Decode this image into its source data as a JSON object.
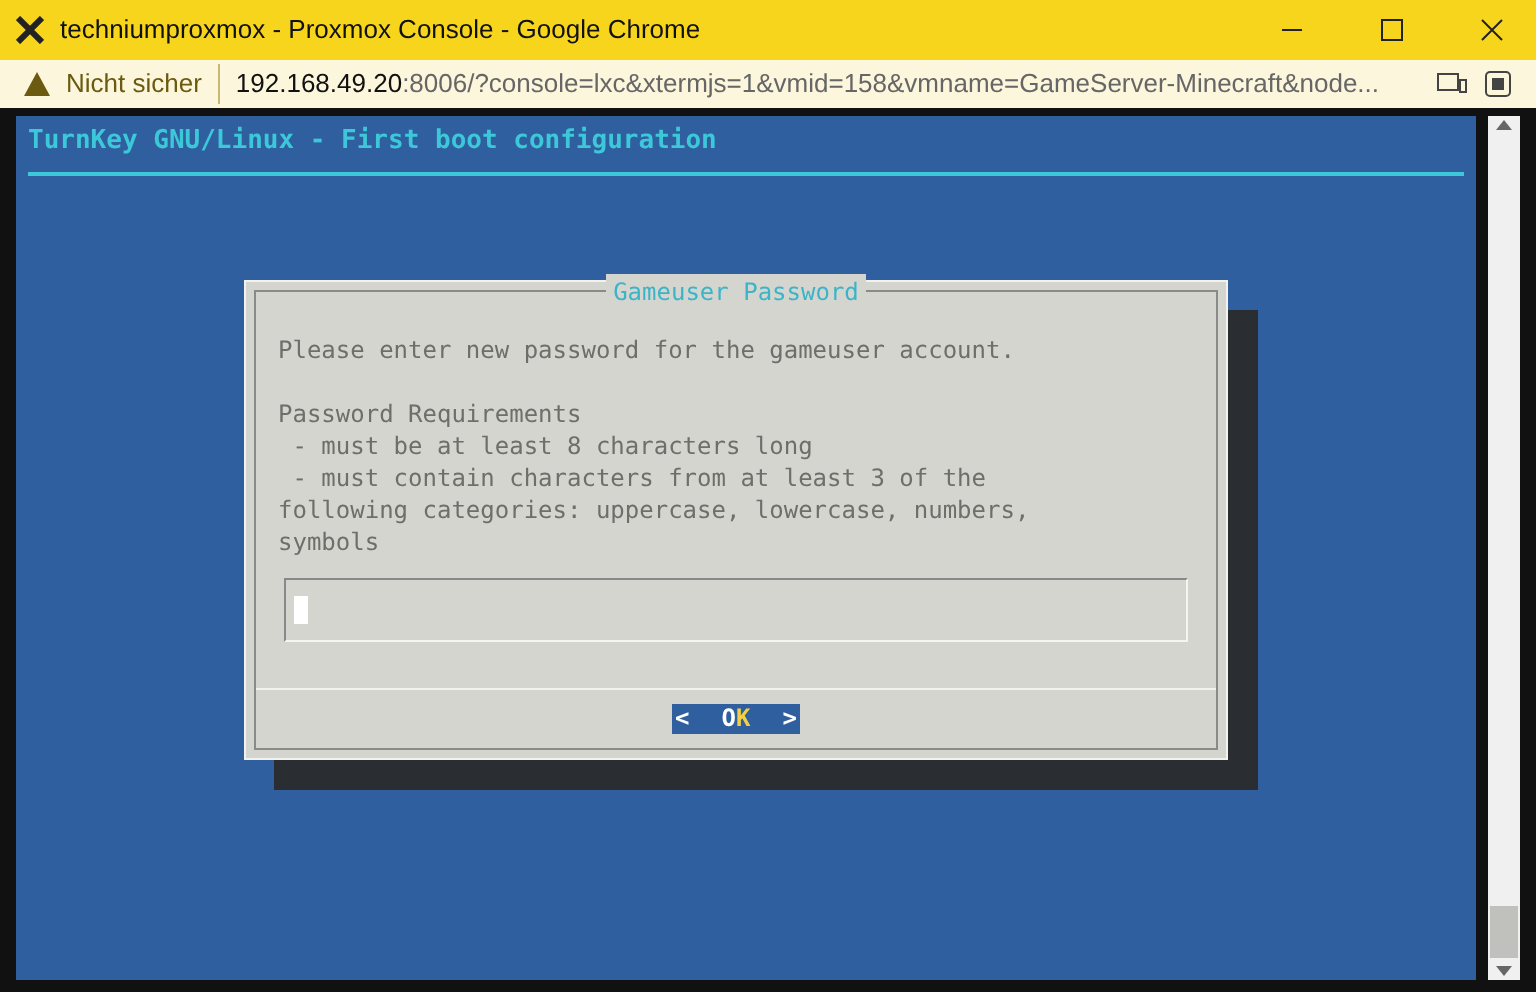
{
  "window": {
    "title": "techniumproxmox - Proxmox Console - Google Chrome"
  },
  "address_bar": {
    "security": "Nicht sicher",
    "host": "192.168.49.20",
    "rest": ":8006/?console=lxc&xtermjs=1&vmid=158&vmname=GameServer-Minecraft&node..."
  },
  "terminal": {
    "header": "TurnKey GNU/Linux - First boot configuration",
    "dialog": {
      "title": "Gameuser Password",
      "paragraphs": [
        [
          "Please enter new password for the gameuser account."
        ],
        [
          "Password Requirements",
          " - must be at least 8 characters long",
          " - must contain characters from at least 3 of the",
          "following categories: uppercase, lowercase, numbers,",
          "symbols"
        ]
      ],
      "button": {
        "left": "<",
        "label": "OK",
        "right": ">",
        "selected": true
      }
    }
  }
}
